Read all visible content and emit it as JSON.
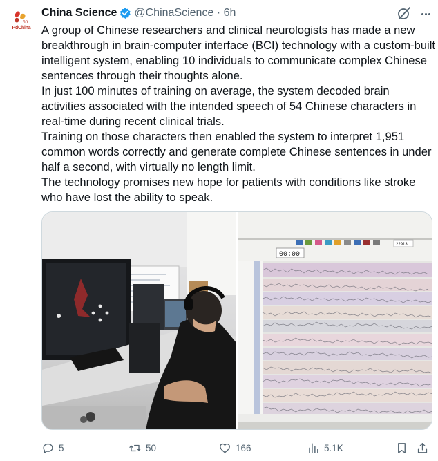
{
  "author": {
    "name": "China Science",
    "handle": "@ChinaScience",
    "time": "6h",
    "avatar_text": "PdChina"
  },
  "tweet": {
    "paragraphs": [
      "A group of Chinese researchers and clinical neurologists has made a new breakthrough in brain-computer interface (BCI) technology with a custom-built intelligent system, enabling 10 individuals to communicate complex Chinese sentences through their thoughts alone.",
      "In just 100 minutes of training on average, the system decoded brain activities associated with the intended speech of 54 Chinese characters in real-time during recent clinical trials.",
      "Training on those characters then enabled the system to interpret 1,951 common words correctly and generate complete Chinese sentences in under half a second, with virtually no length limit.",
      "The technology promises new hope for patients with conditions like stroke who have lost the ability to speak."
    ]
  },
  "media": {
    "right_screen": {
      "timer": "00:00",
      "counter": "22913"
    }
  },
  "actions": {
    "replies": "5",
    "reposts": "50",
    "likes": "166",
    "views": "5.1K"
  },
  "colors": {
    "text": "#0f1419",
    "secondary": "#536471",
    "verified": "#1d9bf0",
    "border": "#cfd9de"
  },
  "icons": [
    "verified-badge-icon",
    "grok-icon",
    "more-icon",
    "reply-icon",
    "repost-icon",
    "like-icon",
    "views-icon",
    "bookmark-icon",
    "share-icon"
  ]
}
